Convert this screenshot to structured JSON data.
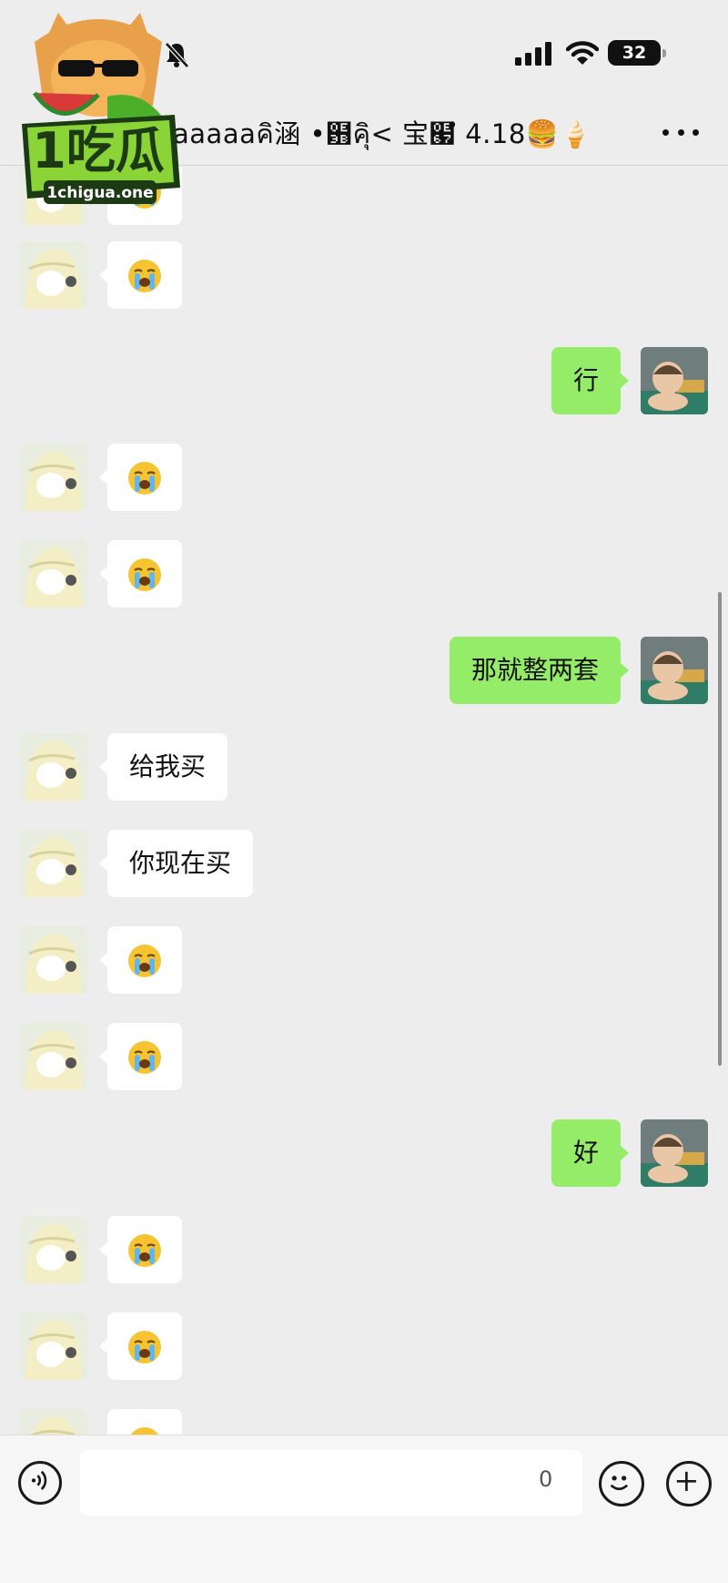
{
  "status_bar": {
    "battery": "32",
    "icons": [
      "mute-icon",
      "cellular-signal-icon",
      "wifi-icon",
      "battery-icon"
    ]
  },
  "header": {
    "title": "aaaaaคิ涵 •฻คิุ< 宝๧ํ 4.18🍔🍦",
    "more_icon": "more-icon"
  },
  "watermark": {
    "brand": "1吃瓜",
    "url": "1chigua.one"
  },
  "messages": [
    {
      "side": "them",
      "type": "emoji",
      "content": "😭"
    },
    {
      "side": "them",
      "type": "emoji",
      "content": "😭"
    },
    {
      "side": "me",
      "type": "text",
      "content": "行"
    },
    {
      "side": "them",
      "type": "emoji",
      "content": "😭"
    },
    {
      "side": "them",
      "type": "emoji",
      "content": "😭"
    },
    {
      "side": "me",
      "type": "text",
      "content": "那就整两套"
    },
    {
      "side": "them",
      "type": "text",
      "content": "给我买"
    },
    {
      "side": "them",
      "type": "text",
      "content": "你现在买"
    },
    {
      "side": "them",
      "type": "emoji",
      "content": "😭"
    },
    {
      "side": "them",
      "type": "emoji",
      "content": "😭"
    },
    {
      "side": "me",
      "type": "text",
      "content": "好"
    },
    {
      "side": "them",
      "type": "emoji",
      "content": "😭"
    },
    {
      "side": "them",
      "type": "emoji",
      "content": "😭"
    },
    {
      "side": "them",
      "type": "emoji",
      "content": "😭"
    }
  ],
  "input_bar": {
    "value": "",
    "cursor_char": "0",
    "icons": [
      "voice-icon",
      "emoji-icon",
      "plus-icon"
    ]
  },
  "colors": {
    "background": "#ededed",
    "my_bubble": "#95ec69",
    "their_bubble": "#ffffff"
  }
}
